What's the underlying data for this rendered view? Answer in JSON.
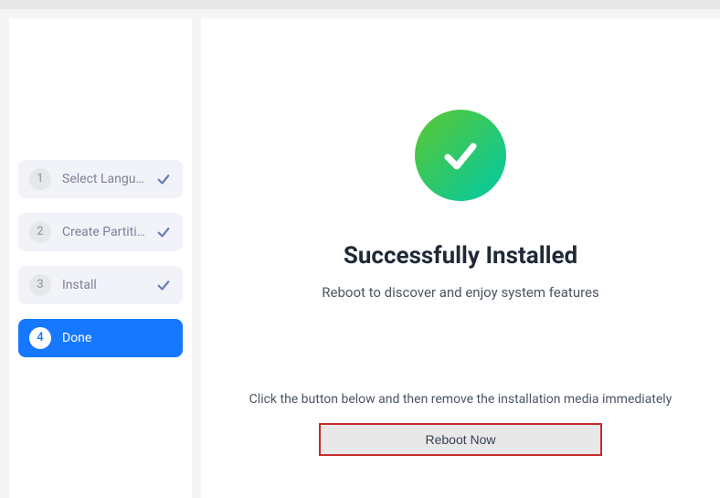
{
  "sidebar": {
    "steps": [
      {
        "number": "1",
        "label": "Select Langu…"
      },
      {
        "number": "2",
        "label": "Create Partiti…"
      },
      {
        "number": "3",
        "label": "Install"
      },
      {
        "number": "4",
        "label": "Done"
      }
    ]
  },
  "main": {
    "title": "Successfully Installed",
    "subtitle": "Reboot to discover and enjoy system features",
    "instruction": "Click the button below and then remove the installation media immediately",
    "reboot_label": "Reboot Now"
  }
}
